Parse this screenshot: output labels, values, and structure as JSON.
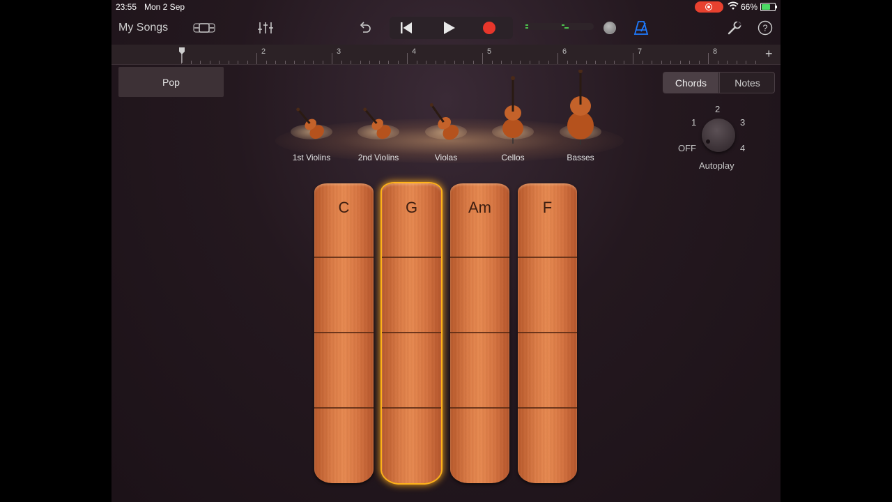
{
  "status_bar": {
    "time": "23:55",
    "date": "Mon 2 Sep",
    "battery": "66%",
    "battery_level": 0.66
  },
  "toolbar": {
    "my_songs": "My Songs",
    "icons": [
      "tracks-view-icon",
      "mixer-icon",
      "undo-icon",
      "rewind-icon",
      "play-icon",
      "record-icon",
      "metronome-icon",
      "settings-wrench-icon",
      "help-icon"
    ],
    "colors": {
      "record": "#e8362b",
      "metronome": "#1e7bff"
    }
  },
  "ruler": {
    "bars": [
      "2",
      "3",
      "4",
      "5",
      "6",
      "7",
      "8"
    ]
  },
  "preset": {
    "label": "Pop"
  },
  "instruments": [
    {
      "name": "1st Violins",
      "icon": "violin-icon"
    },
    {
      "name": "2nd Violins",
      "icon": "violin-icon"
    },
    {
      "name": "Violas",
      "icon": "viola-icon"
    },
    {
      "name": "Cellos",
      "icon": "cello-icon"
    },
    {
      "name": "Basses",
      "icon": "double-bass-icon"
    }
  ],
  "mode": {
    "options": [
      "Chords",
      "Notes"
    ],
    "selected": "Chords"
  },
  "autoplay": {
    "label": "Autoplay",
    "positions": [
      "OFF",
      "1",
      "2",
      "3",
      "4"
    ],
    "selected": "OFF"
  },
  "chords": [
    {
      "name": "C",
      "selected": false
    },
    {
      "name": "G",
      "selected": true
    },
    {
      "name": "Am",
      "selected": false
    },
    {
      "name": "F",
      "selected": false
    }
  ]
}
